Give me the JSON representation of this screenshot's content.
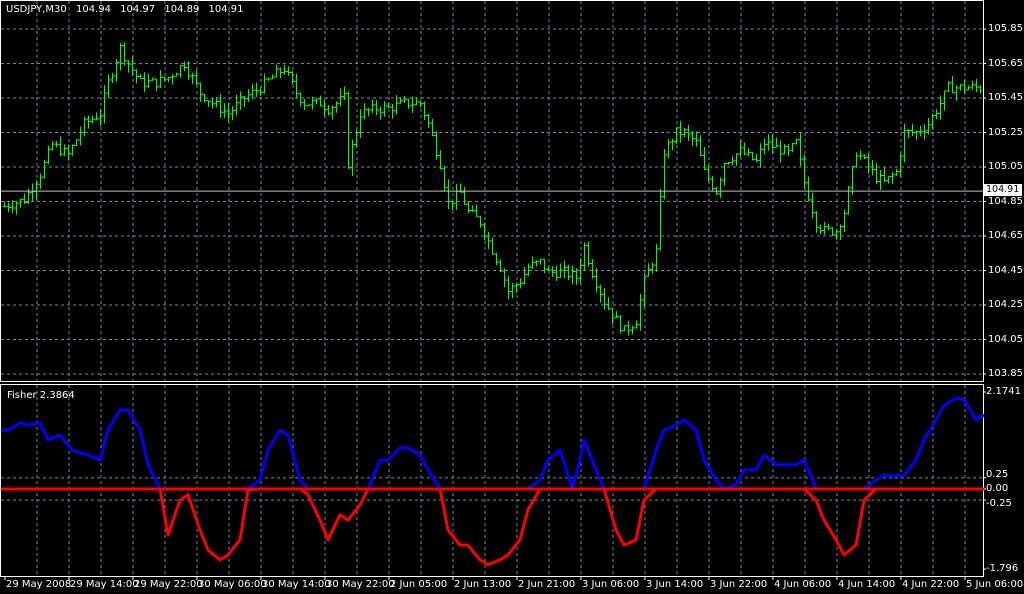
{
  "header": {
    "symbol": "USDJPY,M30",
    "open": "104.94",
    "high": "104.97",
    "low": "104.89",
    "close": "104.91"
  },
  "price_axis": {
    "labels": [
      "105.85",
      "105.65",
      "105.45",
      "105.25",
      "105.05",
      "104.85",
      "104.65",
      "104.45",
      "104.25",
      "104.05",
      "103.85"
    ],
    "current_price": "104.91",
    "range": [
      103.85,
      105.85
    ]
  },
  "indicator": {
    "label": "Fisher 2.3864",
    "axis_labels": {
      "max": "2.1741",
      "upper": "0.25",
      "zero": "0.00",
      "lower": "-0.25",
      "min": "-1.796"
    },
    "range": [
      -1.796,
      2.1741
    ],
    "levels": [
      0.25,
      -0.25
    ],
    "colors": {
      "positive": "#0000ff",
      "negative": "#ff0000"
    },
    "bars": [
      1,
      4,
      6,
      9,
      11,
      14,
      17,
      21,
      24,
      26,
      29,
      31,
      34,
      36,
      39,
      41,
      44,
      46,
      49,
      51,
      54,
      56,
      59,
      61,
      64,
      66,
      69,
      71,
      74,
      76,
      79,
      81,
      84,
      86,
      89,
      91,
      94,
      96,
      99,
      101,
      104,
      106,
      109,
      111,
      114,
      116,
      119,
      121,
      124,
      126,
      129,
      131,
      134,
      136,
      139,
      141,
      142,
      144,
      145,
      148,
      150,
      153,
      155,
      158,
      160,
      163,
      165,
      168,
      170,
      173,
      175,
      178,
      180,
      183,
      185,
      188,
      190,
      193,
      195,
      198,
      200,
      203,
      205,
      208,
      210,
      213,
      215,
      218,
      220,
      223,
      225,
      228,
      230,
      233,
      235,
      238,
      240,
      243,
      245
    ],
    "values": [
      1.32,
      1.48,
      1.43,
      1.48,
      1.1,
      1.21,
      0.87,
      0.76,
      0.65,
      1.32,
      1.77,
      1.77,
      1.32,
      0.54,
      0,
      -1.03,
      -0.25,
      -0.13,
      -0.92,
      -1.37,
      -1.59,
      -1.48,
      -1.14,
      -0.02,
      0.2,
      0.87,
      1.32,
      1.21,
      0.2,
      -0.13,
      -0.7,
      -1.14,
      -0.58,
      -0.7,
      -0.36,
      0,
      0.65,
      0.65,
      0.92,
      0.92,
      0.76,
      0.43,
      0,
      -0.92,
      -1.26,
      -1.26,
      -1.59,
      -1.7,
      -1.59,
      -1.48,
      -1.14,
      -0.47,
      0.2,
      0.65,
      0.87,
      0.31,
      0,
      0.65,
      1.1,
      0.43,
      0,
      -0.92,
      -1.26,
      -1.14,
      -0.25,
      0.87,
      1.32,
      1.43,
      1.55,
      1.32,
      0.65,
      0.2,
      0,
      0.09,
      0.43,
      0.43,
      0.76,
      0.54,
      0.54,
      0.54,
      0.65,
      -0.25,
      -0.7,
      -1.14,
      -1.48,
      -1.26,
      -0.25,
      0.2,
      0.31,
      0.29,
      0.31,
      0.65,
      1.1,
      1.55,
      1.88,
      2.04,
      2.0,
      1.55,
      1.66
    ]
  },
  "price_series": {
    "bars": [
      1,
      5,
      9,
      12,
      16,
      20,
      24,
      26,
      29,
      31,
      34,
      38,
      41,
      45,
      49,
      52,
      56,
      60,
      64,
      68,
      70,
      73,
      75,
      79,
      81,
      85,
      86,
      89,
      93,
      96,
      100,
      104,
      106,
      109,
      111,
      114,
      116,
      119,
      121,
      124,
      126,
      129,
      131,
      134,
      136,
      140,
      143,
      145,
      147,
      150,
      153,
      155,
      158,
      160,
      163,
      165,
      168,
      170,
      173,
      175,
      178,
      180,
      184,
      188,
      190,
      193,
      196,
      198,
      200,
      203,
      205,
      208,
      210,
      213,
      215,
      218,
      220,
      223,
      225,
      228,
      231,
      234,
      236,
      239,
      242,
      245
    ],
    "closes": [
      104.83,
      104.86,
      105.01,
      105.18,
      105.12,
      105.3,
      105.36,
      105.54,
      105.74,
      105.65,
      105.54,
      105.54,
      105.57,
      105.65,
      105.48,
      105.42,
      105.36,
      105.45,
      105.51,
      105.59,
      105.62,
      105.48,
      105.42,
      105.42,
      105.39,
      105.45,
      105.07,
      105.36,
      105.39,
      105.39,
      105.42,
      105.42,
      105.3,
      105.07,
      104.84,
      104.9,
      104.79,
      104.73,
      104.62,
      104.47,
      104.33,
      104.39,
      104.47,
      104.5,
      104.44,
      104.44,
      104.41,
      104.59,
      104.44,
      104.27,
      104.16,
      104.1,
      104.16,
      104.39,
      104.56,
      105.14,
      105.25,
      105.25,
      105.19,
      105.02,
      104.91,
      105.08,
      105.14,
      105.08,
      105.19,
      105.16,
      105.13,
      105.19,
      104.96,
      104.73,
      104.68,
      104.68,
      104.79,
      105.14,
      105.08,
      104.99,
      104.96,
      105.02,
      105.25,
      105.25,
      105.3,
      105.42,
      105.51,
      105.51,
      105.51,
      105.51
    ]
  },
  "time_axis": {
    "labels": [
      "29 May 2008",
      "29 May 14:00",
      "29 May 22:00",
      "30 May 06:00",
      "30 May 14:00",
      "30 May 22:00",
      "2 Jun 05:00",
      "2 Jun 13:00",
      "2 Jun 21:00",
      "3 Jun 06:00",
      "3 Jun 14:00",
      "3 Jun 22:00",
      "4 Jun 06:00",
      "4 Jun 14:00",
      "4 Jun 22:00",
      "5 Jun 06:00"
    ]
  },
  "colors": {
    "bars": "#00ff00",
    "grid": "#778899",
    "price_line": "#c0c0c0"
  }
}
